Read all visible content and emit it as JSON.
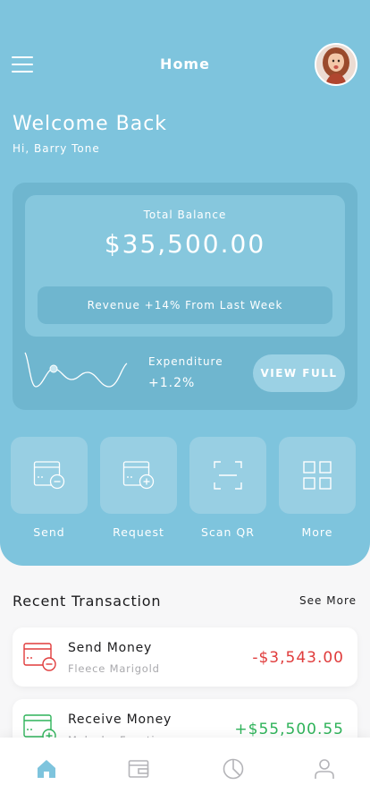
{
  "header": {
    "title": "Home"
  },
  "welcome": {
    "heading": "Welcome Back",
    "greeting": "Hi, Barry Tone"
  },
  "balance": {
    "label": "Total Balance",
    "amount": "$35,500.00",
    "revenue_text": "Revenue +14% From Last Week",
    "expenditure_label": "Expenditure",
    "expenditure_value": "+1.2%",
    "view_full_label": "VIEW FULL"
  },
  "actions": [
    {
      "label": "Send",
      "icon": "card-minus-icon"
    },
    {
      "label": "Request",
      "icon": "card-plus-icon"
    },
    {
      "label": "Scan QR",
      "icon": "scan-qr-icon"
    },
    {
      "label": "More",
      "icon": "grid-icon"
    }
  ],
  "transactions_section": {
    "title": "Recent Transaction",
    "see_more": "See More"
  },
  "transactions": [
    {
      "title": "Send Money",
      "name": "Fleece Marigold",
      "amount": "-$3,543.00",
      "color": "#e03c3c",
      "icon": "card-minus-icon"
    },
    {
      "title": "Receive Money",
      "name": "Malcolm Function",
      "amount": "+$55,500.55",
      "color": "#2fb35a",
      "icon": "card-plus-icon"
    }
  ],
  "tabbar": {
    "active_color": "#7ec4dd",
    "inactive_color": "#b4b4b8",
    "tabs": [
      "home-icon",
      "wallet-icon",
      "pie-chart-icon",
      "user-icon"
    ]
  },
  "colors": {
    "brand": "#7ec4dd",
    "negative": "#e03c3c",
    "positive": "#2fb35a"
  }
}
